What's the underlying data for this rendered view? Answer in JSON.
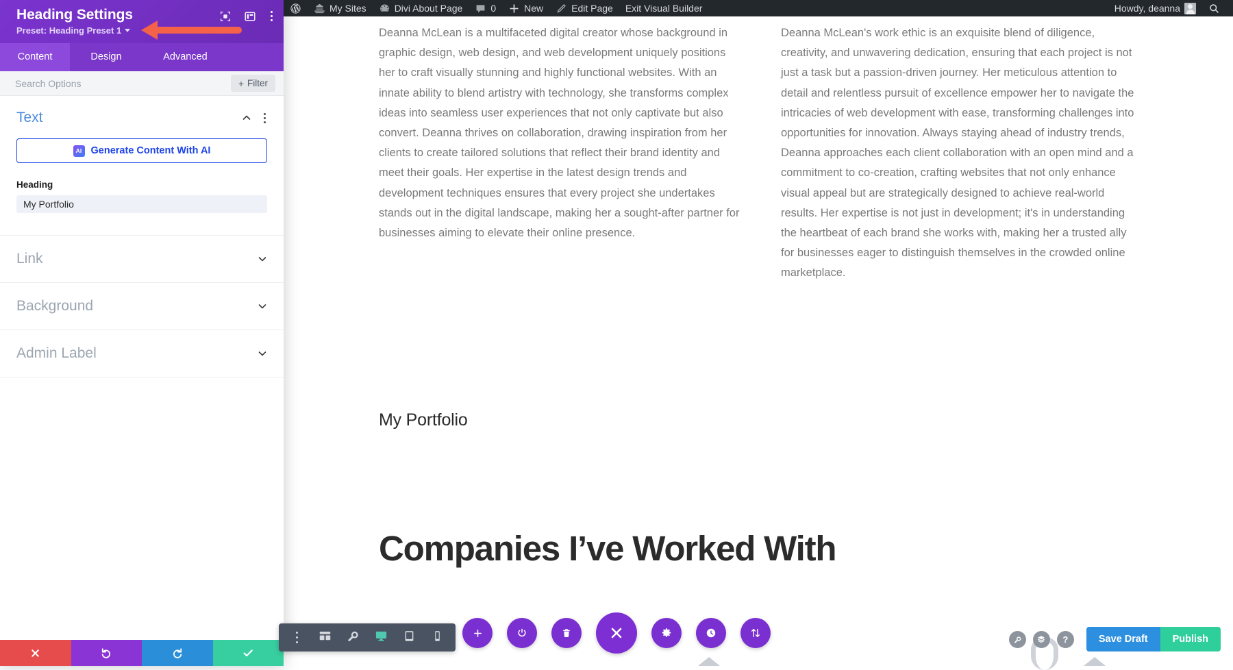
{
  "admin_bar": {
    "items": [
      {
        "id": "wp-logo",
        "label": "",
        "icon": "wordpress-logo-icon"
      },
      {
        "id": "my-sites",
        "label": "My Sites",
        "icon": "sites-icon"
      },
      {
        "id": "site-name",
        "label": "Divi About Page",
        "icon": "dashboard-icon"
      },
      {
        "id": "comments",
        "label": "0",
        "icon": "comment-bubble-icon"
      },
      {
        "id": "new-content",
        "label": "New",
        "icon": "plus-icon"
      },
      {
        "id": "edit-page",
        "label": "Edit Page",
        "icon": "pencil-icon"
      },
      {
        "id": "exit-visual-builder",
        "label": "Exit Visual Builder",
        "icon": ""
      }
    ],
    "howdy": "Howdy, deanna",
    "search_icon": "search-icon",
    "avatar": "user-avatar"
  },
  "settings_panel": {
    "title": "Heading Settings",
    "preset": "Preset: Heading Preset 1",
    "header_icons": [
      "focus-target-icon",
      "layout-columns-icon",
      "kebab-menu-icon"
    ],
    "tabs": [
      {
        "id": "content",
        "label": "Content",
        "active": true
      },
      {
        "id": "design",
        "label": "Design",
        "active": false
      },
      {
        "id": "advanced",
        "label": "Advanced",
        "active": false
      }
    ],
    "search": {
      "placeholder": "Search Options",
      "value": "",
      "filter_label": "Filter",
      "filter_plus": "+"
    },
    "sections": [
      {
        "id": "text",
        "title": "Text",
        "open": true,
        "ai_button": "Generate Content With AI",
        "ai_badge": "AI",
        "field_label": "Heading",
        "field_value": "My Portfolio"
      },
      {
        "id": "link",
        "title": "Link",
        "open": false
      },
      {
        "id": "background",
        "title": "Background",
        "open": false
      },
      {
        "id": "admin-label",
        "title": "Admin Label",
        "open": false
      }
    ],
    "footer_buttons": [
      {
        "id": "cancel",
        "icon": "close-x-icon",
        "color": "#e74c4c"
      },
      {
        "id": "undo",
        "icon": "undo-arrow-icon",
        "color": "#8b34d6"
      },
      {
        "id": "redo",
        "icon": "redo-arrow-icon",
        "color": "#2a8fd8"
      },
      {
        "id": "save",
        "icon": "checkmark-icon",
        "color": "#37cfa0"
      }
    ]
  },
  "annotation": {
    "arrow_color": "#f4624a",
    "points_to": "Preset: Heading Preset 1"
  },
  "canvas": {
    "paragraph_left": "Deanna McLean is a multifaceted digital creator whose background in graphic design, web design, and web development uniquely positions her to craft visually stunning and highly functional websites. With an innate ability to blend artistry with technology, she transforms complex ideas into seamless user experiences that not only captivate but also convert. Deanna thrives on collaboration, drawing inspiration from her clients to create tailored solutions that reflect their brand identity and meet their goals. Her expertise in the latest design trends and development techniques ensures that every project she undertakes stands out in the digital landscape, making her a sought-after partner for businesses aiming to elevate their online presence.",
    "paragraph_right": "Deanna McLean's work ethic is an exquisite blend of diligence, creativity, and unwavering dedication, ensuring that each project is not just a task but a passion-driven journey. Her meticulous attention to detail and relentless pursuit of excellence empower her to navigate the intricacies of web development with ease, transforming challenges into opportunities for innovation. Always staying ahead of industry trends, Deanna approaches each client collaboration with an open mind and a commitment to co-creation, crafting websites that not only enhance visual appeal but are strategically designed to achieve real-world results. Her expertise is not just in development; it's in understanding the heartbeat of each brand she works with, making her a trusted ally for businesses eager to distinguish themselves in the crowded online marketplace.",
    "portfolio_heading": "My Portfolio",
    "companies_heading": "Companies I’ve Worked With"
  },
  "bottom_left_toolbar": {
    "items": [
      {
        "id": "more-options",
        "icon": "kebab-menu-icon",
        "active": false
      },
      {
        "id": "wireframe-view",
        "icon": "wireframe-icon",
        "active": false
      },
      {
        "id": "zoom-out-view",
        "icon": "magnifier-icon",
        "active": false
      },
      {
        "id": "desktop-view",
        "icon": "desktop-monitor-icon",
        "active": true
      },
      {
        "id": "tablet-view",
        "icon": "tablet-icon",
        "active": false
      },
      {
        "id": "phone-view",
        "icon": "phone-icon",
        "active": false
      }
    ],
    "active_color": "#4ec9b0"
  },
  "bottom_center_toolbar": {
    "items": [
      {
        "id": "add-module",
        "icon": "plus-icon",
        "size": "small"
      },
      {
        "id": "toggle-builder",
        "icon": "power-icon",
        "size": "small"
      },
      {
        "id": "delete",
        "icon": "trash-icon",
        "size": "small"
      },
      {
        "id": "close-menu",
        "icon": "close-x-icon",
        "size": "large"
      },
      {
        "id": "settings",
        "icon": "gear-icon",
        "size": "small"
      },
      {
        "id": "history",
        "icon": "clock-icon",
        "size": "small"
      },
      {
        "id": "sort-order",
        "icon": "up-down-arrows-icon",
        "size": "small"
      }
    ],
    "color": "#7a2fd0"
  },
  "bottom_right_toolbar": {
    "icons": [
      {
        "id": "search-page",
        "icon": "magnifier-icon"
      },
      {
        "id": "layers",
        "icon": "layers-icon"
      },
      {
        "id": "help",
        "icon": "question-mark-icon",
        "glyph": "?"
      }
    ],
    "save_draft_label": "Save Draft",
    "publish_label": "Publish",
    "save_draft_color": "#2d8fe0",
    "publish_color": "#2ecf9a"
  }
}
